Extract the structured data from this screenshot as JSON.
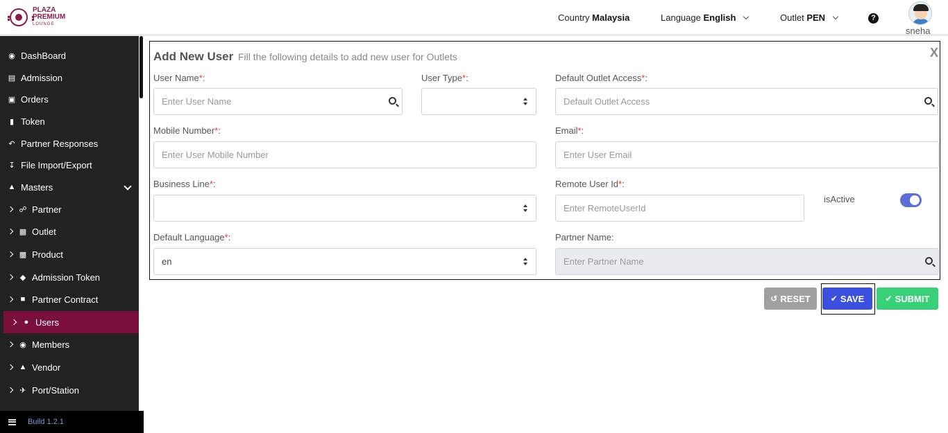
{
  "header": {
    "logo": {
      "line1": "PLAZA",
      "line2": "PREMIUM",
      "line3": "LOUNGE"
    },
    "country_label": "Country",
    "country_value": "Malaysia",
    "language_label": "Language",
    "language_value": "English",
    "outlet_label": "Outlet",
    "outlet_value": "PEN",
    "help_icon": "?",
    "user_name": "sneha"
  },
  "sidebar": {
    "items": [
      {
        "label": "DashBoard",
        "icon": "dashboard-icon"
      },
      {
        "label": "Admission",
        "icon": "id-card-icon"
      },
      {
        "label": "Orders",
        "icon": "cart-icon"
      },
      {
        "label": "Token",
        "icon": "file-icon"
      },
      {
        "label": "Partner Responses",
        "icon": "reply-icon"
      },
      {
        "label": "File Import/Export",
        "icon": "download-icon"
      },
      {
        "label": "Masters",
        "icon": "sitemap-icon"
      },
      {
        "label": "Partner",
        "icon": "handshake-icon"
      },
      {
        "label": "Outlet",
        "icon": "building-icon"
      },
      {
        "label": "Product",
        "icon": "gift-icon"
      },
      {
        "label": "Admission Token",
        "icon": "tag-icon"
      },
      {
        "label": "Partner Contract",
        "icon": "briefcase-icon"
      },
      {
        "label": "Users",
        "icon": "user-icon"
      },
      {
        "label": "Members",
        "icon": "users-icon"
      },
      {
        "label": "Vendor",
        "icon": "male-icon"
      },
      {
        "label": "Port/Station",
        "icon": "plane-icon"
      }
    ],
    "build": "Build 1.2.1"
  },
  "form": {
    "title": "Add New User",
    "subtitle": "Fill the following details to add new user for Outlets",
    "close": "X",
    "user_name": {
      "label": "User Name",
      "placeholder": "Enter User Name"
    },
    "user_type": {
      "label": "User Type",
      "value": ""
    },
    "default_outlet_access": {
      "label": "Default Outlet Access",
      "placeholder": "Default Outlet Access"
    },
    "mobile_number": {
      "label": "Mobile Number",
      "placeholder": "Enter User Mobile Number"
    },
    "email": {
      "label": "Email",
      "placeholder": "Enter User Email"
    },
    "business_line": {
      "label": "Business Line",
      "value": ""
    },
    "remote_user_id": {
      "label": "Remote User Id",
      "placeholder": "Enter RemoteUserId"
    },
    "is_active": {
      "label": "isActive",
      "checked": true
    },
    "default_language": {
      "label": "Default Language",
      "value": "en"
    },
    "partner_name": {
      "label": "Partner Name:",
      "placeholder": "Enter Partner Name"
    },
    "required_mark": "*",
    "colon": ":"
  },
  "actions": {
    "reset": "RESET",
    "save": "SAVE",
    "submit": "SUBMIT"
  },
  "colors": {
    "brand": "#8b1a4a",
    "sidebar_active": "#7a0f3d",
    "save": "#3c50e0",
    "submit": "#38d17a",
    "reset": "#a0a0a0",
    "toggle_on": "#5b6fd6"
  }
}
